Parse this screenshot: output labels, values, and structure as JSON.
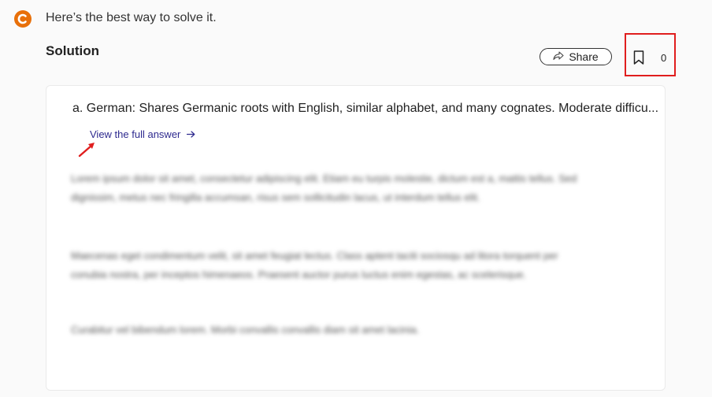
{
  "header": {
    "intro_text": "Here’s the best way to solve it.",
    "logo_icon": "chegg-c-logo-icon"
  },
  "solution": {
    "title": "Solution",
    "share_label": "Share",
    "share_icon": "share-arrow-icon",
    "bookmark_icon": "bookmark-icon",
    "bookmark_count": "0"
  },
  "card": {
    "answer_preview": "a. German: Shares Germanic roots with English, similar alphabet, and many cognates. Moderate difficu...",
    "view_full_answer": "View the full answer",
    "view_full_icon": "arrow-right-icon",
    "blurred_paragraphs": [
      "Lorem ipsum dolor sit amet, consectetur adipiscing elit. Etiam eu turpis molestie, dictum est a, mattis tellus. Sed dignissim, metus nec fringilla accumsan, risus sem sollicitudin lacus, ut interdum tellus elit.",
      "Maecenas eget condimentum velit, sit amet feugiat lectus. Class aptent taciti sociosqu ad litora torquent per conubia nostra, per inceptos himenaeos. Praesent auctor purus luctus enim egestas, ac scelerisque.",
      "Curabitur vel bibendum lorem. Morbi convallis convallis diam sit amet lacinia."
    ]
  },
  "colors": {
    "logo_orange": "#e8700a",
    "link_color": "#2e2a8f",
    "highlight_red": "#e01e1e"
  }
}
